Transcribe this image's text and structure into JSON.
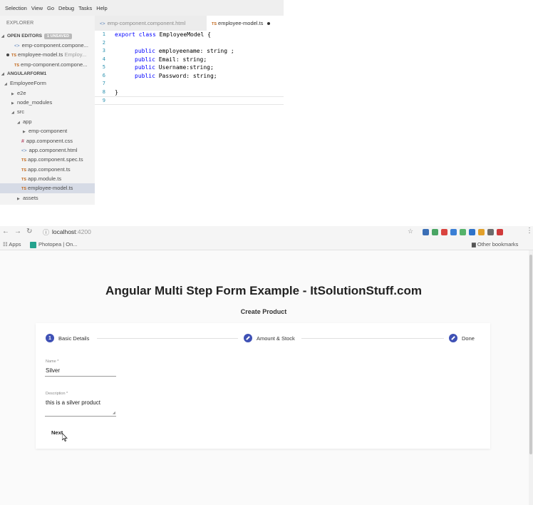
{
  "vscode": {
    "menu": [
      "Selection",
      "View",
      "Go",
      "Debug",
      "Tasks",
      "Help"
    ],
    "explorer_title": "EXPLORER",
    "open_editors": {
      "label": "OPEN EDITORS",
      "badge": "1 UNSAVED",
      "items": [
        {
          "name": "emp-component.compone...",
          "detail": ""
        },
        {
          "name": "employee-model.ts",
          "detail": "Employ..."
        },
        {
          "name": "emp-component.compone...",
          "detail": ""
        }
      ]
    },
    "project": {
      "label": "ANGULARFORM1",
      "root": "EmployeeForm",
      "items": [
        "e2e",
        "node_modules",
        "src",
        "app",
        "emp-component",
        "app.component.css",
        "app.component.html",
        "app.component.spec.ts",
        "app.component.ts",
        "app.module.ts",
        "employee-model.ts",
        "assets"
      ]
    },
    "tabs": [
      {
        "label": "emp-component.component.html"
      },
      {
        "label": "employee-model.ts"
      }
    ],
    "code": {
      "line_numbers": [
        "1",
        "2",
        "3",
        "4",
        "5",
        "6",
        "7",
        "8",
        "9"
      ],
      "class_decl": "EmployeeModel {",
      "fields": [
        "employeename: string ;",
        "Email: string;",
        "Username:string;",
        "Password: string;"
      ],
      "kw_export": "export",
      "kw_class": "class",
      "kw_public": "public",
      "close_brace": "}"
    }
  },
  "browser": {
    "url_host": "localhost",
    "url_port": ":4200",
    "bookmarks": {
      "apps": "Apps",
      "photopea": "Photopea | On...",
      "other": "Other bookmarks"
    }
  },
  "app": {
    "title": "Angular Multi Step Form Example - ItSolutionStuff.com",
    "subtitle": "Create Product",
    "steps": [
      {
        "number": "1",
        "label": "Basic Details"
      },
      {
        "label": "Amount & Stock"
      },
      {
        "label": "Done"
      }
    ],
    "fields": {
      "name": {
        "label": "Name *",
        "value": "Silver"
      },
      "description": {
        "label": "Description *",
        "value": "this is a silver product"
      }
    },
    "next_label": "Next"
  },
  "colors": {
    "primary": "#3f51b5",
    "ts_icon": "#c1661a",
    "html_icon": "#5b84bb",
    "keyword": "#0000ff",
    "line_number": "#2b91af"
  }
}
